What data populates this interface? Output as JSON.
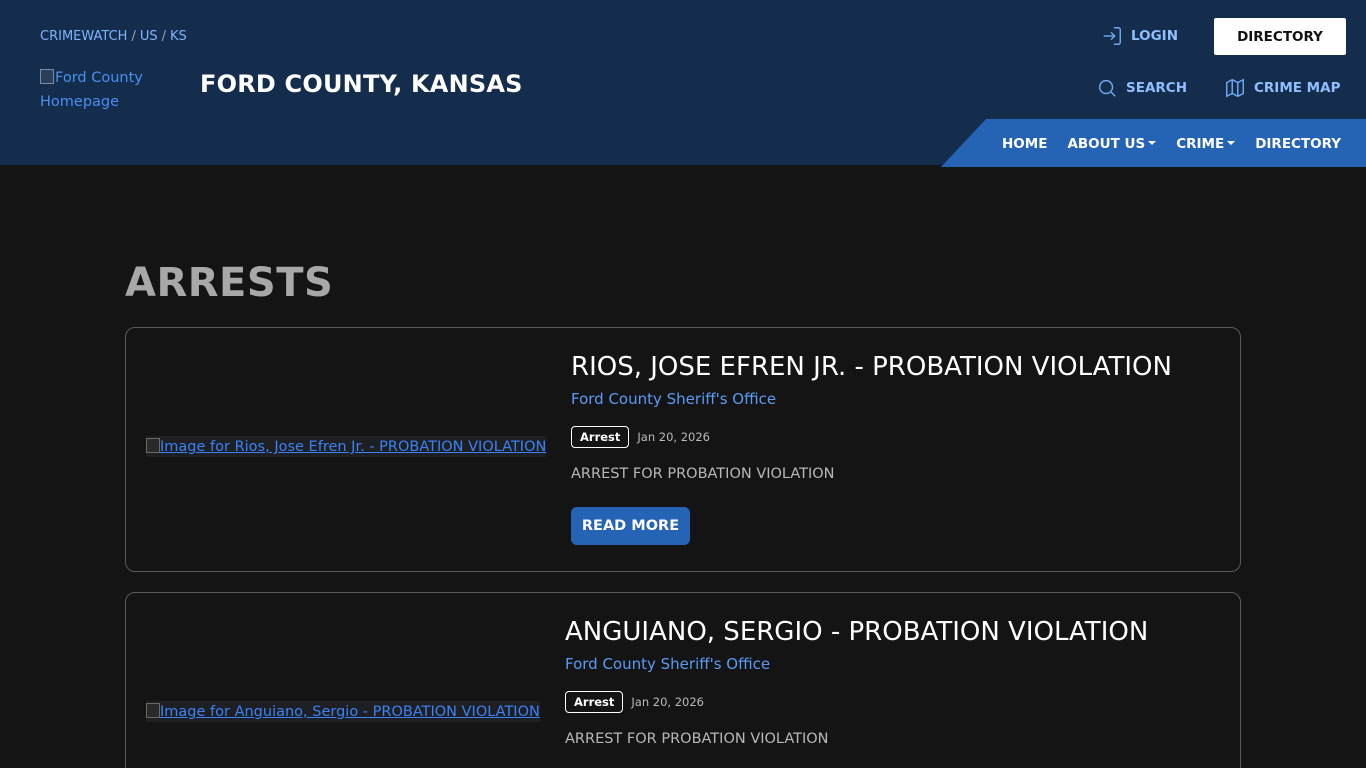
{
  "header": {
    "breadcrumb": [
      "CRIMEWATCH",
      "US",
      "KS"
    ],
    "breadcrumb_sep": "/",
    "logo_alt": "Ford County Homepage",
    "site_title": "FORD COUNTY, KANSAS",
    "login_label": "LOGIN",
    "directory_button": "DIRECTORY",
    "search_label": "SEARCH",
    "crime_map_label": "CRIME MAP"
  },
  "nav": {
    "items": [
      "HOME",
      "ABOUT US",
      "CRIME",
      "DIRECTORY"
    ]
  },
  "main": {
    "page_title": "ARRESTS",
    "cards": [
      {
        "image_alt": "Image for Rios, Jose Efren Jr. - PROBATION VIOLATION",
        "title": "RIOS, JOSE EFREN JR. - PROBATION VIOLATION",
        "agency": "Ford County Sheriff's Office",
        "badge": "Arrest",
        "date": "Jan 20, 2026",
        "description": "ARREST FOR PROBATION VIOLATION",
        "read_more": "READ MORE"
      },
      {
        "image_alt": "Image for Anguiano, Sergio - PROBATION VIOLATION",
        "title": "ANGUIANO, SERGIO - PROBATION VIOLATION",
        "agency": "Ford County Sheriff's Office",
        "badge": "Arrest",
        "date": "Jan 20, 2026",
        "description": "ARREST FOR PROBATION VIOLATION"
      }
    ]
  },
  "colors": {
    "header_bg": "#142d4c",
    "nav_bg": "#2563b5",
    "page_bg": "#141414",
    "link": "#5a9cf5"
  }
}
